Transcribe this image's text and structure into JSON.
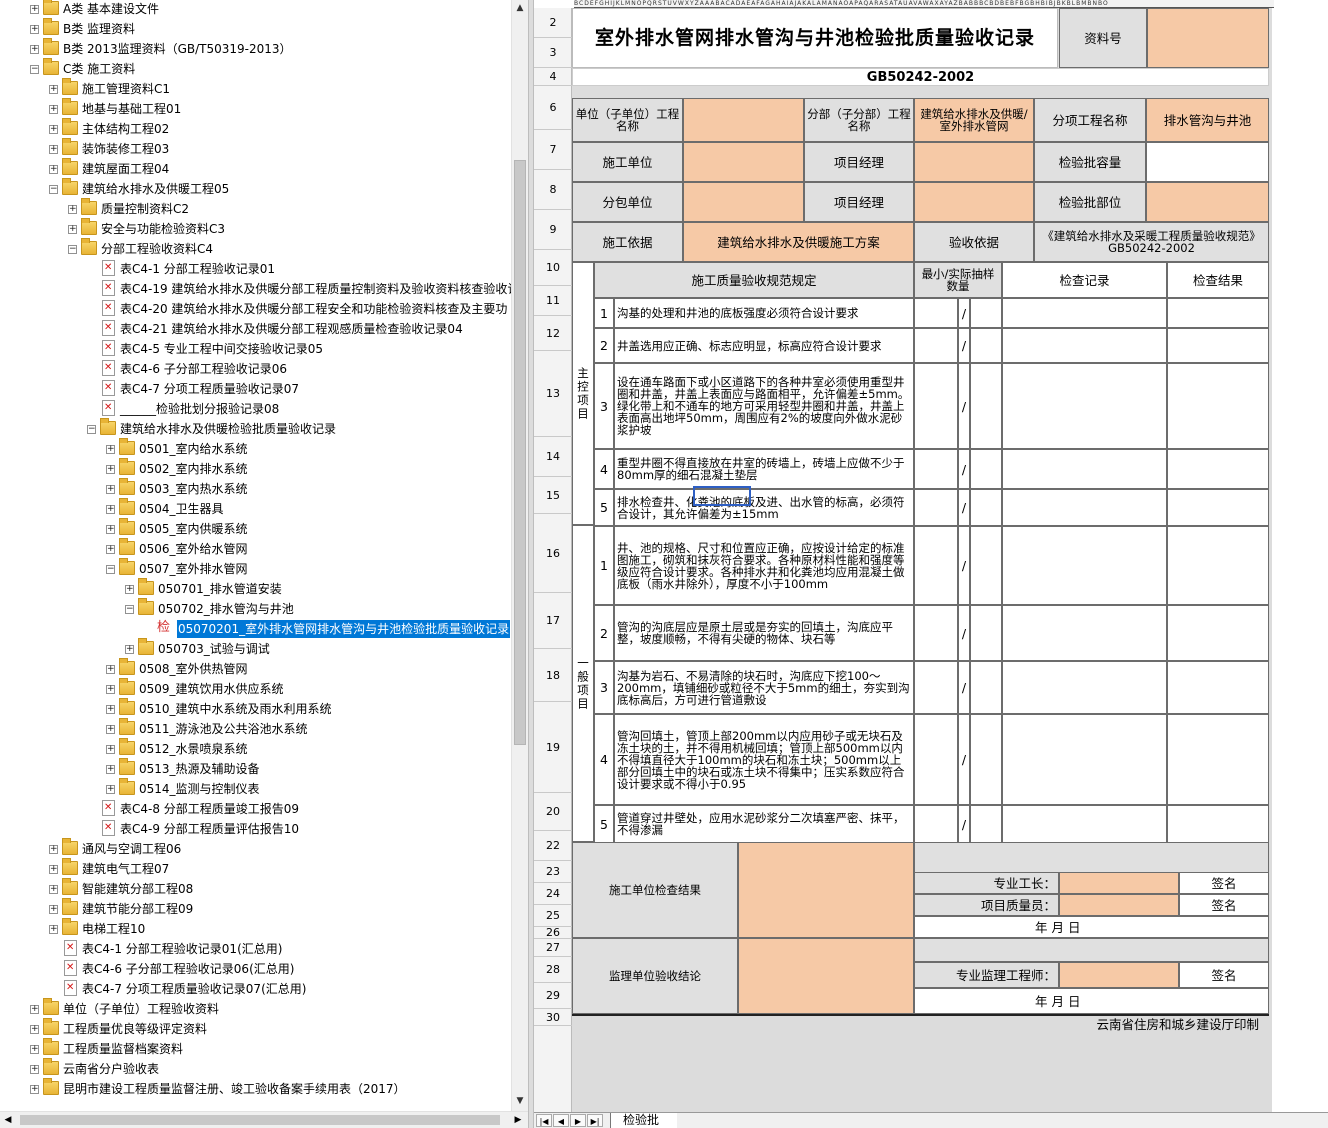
{
  "tree": {
    "items": [
      {
        "label": "A类 基本建设文件",
        "depth": 1,
        "type": "folder",
        "exp": "+"
      },
      {
        "label": "B类 监理资料",
        "depth": 1,
        "type": "folder",
        "exp": "+"
      },
      {
        "label": "B类 2013监理资料（GB/T50319-2013）",
        "depth": 1,
        "type": "folder",
        "exp": "+"
      },
      {
        "label": "C类 施工资料",
        "depth": 1,
        "type": "folder",
        "exp": "-"
      },
      {
        "label": "施工管理资料C1",
        "depth": 2,
        "type": "folder",
        "exp": "+"
      },
      {
        "label": "地基与基础工程01",
        "depth": 2,
        "type": "folder",
        "exp": "+"
      },
      {
        "label": "主体结构工程02",
        "depth": 2,
        "type": "folder",
        "exp": "+"
      },
      {
        "label": "装饰装修工程03",
        "depth": 2,
        "type": "folder",
        "exp": "+"
      },
      {
        "label": "建筑屋面工程04",
        "depth": 2,
        "type": "folder",
        "exp": "+"
      },
      {
        "label": "建筑给水排水及供暖工程05",
        "depth": 2,
        "type": "folder",
        "exp": "-"
      },
      {
        "label": "质量控制资料C2",
        "depth": 3,
        "type": "folder",
        "exp": "+"
      },
      {
        "label": "安全与功能检验资料C3",
        "depth": 3,
        "type": "folder",
        "exp": "+"
      },
      {
        "label": "分部工程验收资料C4",
        "depth": 3,
        "type": "folder",
        "exp": "-"
      },
      {
        "label": "表C4-1 分部工程验收记录01",
        "depth": 4,
        "type": "xls"
      },
      {
        "label": "表C4-19 建筑给水排水及供暖分部工程质量控制资料及验收资料核查验收记",
        "depth": 4,
        "type": "xls"
      },
      {
        "label": "表C4-20 建筑给水排水及供暖分部工程安全和功能检验资料核查及主要功",
        "depth": 4,
        "type": "xls"
      },
      {
        "label": "表C4-21 建筑给水排水及供暖分部工程观感质量检查验收记录04",
        "depth": 4,
        "type": "xls"
      },
      {
        "label": "表C4-5 专业工程中间交接验收记录05",
        "depth": 4,
        "type": "xls"
      },
      {
        "label": "表C4-6 子分部工程验收记录06",
        "depth": 4,
        "type": "xls"
      },
      {
        "label": "表C4-7 分项工程质量验收记录07",
        "depth": 4,
        "type": "xls"
      },
      {
        "label": "______检验批划分报验记录08",
        "depth": 4,
        "type": "xls"
      },
      {
        "label": "建筑给水排水及供暖检验批质量验收记录",
        "depth": 4,
        "type": "folder",
        "exp": "-"
      },
      {
        "label": "0501_室内给水系统",
        "depth": 5,
        "type": "folder",
        "exp": "+"
      },
      {
        "label": "0502_室内排水系统",
        "depth": 5,
        "type": "folder",
        "exp": "+"
      },
      {
        "label": "0503_室内热水系统",
        "depth": 5,
        "type": "folder",
        "exp": "+"
      },
      {
        "label": "0504_卫生器具",
        "depth": 5,
        "type": "folder",
        "exp": "+"
      },
      {
        "label": "0505_室内供暖系统",
        "depth": 5,
        "type": "folder",
        "exp": "+"
      },
      {
        "label": "0506_室外给水管网",
        "depth": 5,
        "type": "folder",
        "exp": "+"
      },
      {
        "label": "0507_室外排水管网",
        "depth": 5,
        "type": "folder",
        "exp": "-"
      },
      {
        "label": "050701_排水管道安装",
        "depth": 6,
        "type": "folder",
        "exp": "+"
      },
      {
        "label": "050702_排水管沟与井池",
        "depth": 6,
        "type": "folder",
        "exp": "-"
      },
      {
        "label": "05070201_室外排水管网排水管沟与井池检验批质量验收记录",
        "depth": 7,
        "type": "check",
        "selected": true,
        "icon_text": "检"
      },
      {
        "label": "050703_试验与调试",
        "depth": 6,
        "type": "folder",
        "exp": "+"
      },
      {
        "label": "0508_室外供热管网",
        "depth": 5,
        "type": "folder",
        "exp": "+"
      },
      {
        "label": "0509_建筑饮用水供应系统",
        "depth": 5,
        "type": "folder",
        "exp": "+"
      },
      {
        "label": "0510_建筑中水系统及雨水利用系统",
        "depth": 5,
        "type": "folder",
        "exp": "+"
      },
      {
        "label": "0511_游泳池及公共浴池水系统",
        "depth": 5,
        "type": "folder",
        "exp": "+"
      },
      {
        "label": "0512_水景喷泉系统",
        "depth": 5,
        "type": "folder",
        "exp": "+"
      },
      {
        "label": "0513_热源及辅助设备",
        "depth": 5,
        "type": "folder",
        "exp": "+"
      },
      {
        "label": "0514_监测与控制仪表",
        "depth": 5,
        "type": "folder",
        "exp": "+"
      },
      {
        "label": "表C4-8 分部工程质量竣工报告09",
        "depth": 4,
        "type": "xls"
      },
      {
        "label": "表C4-9 分部工程质量评估报告10",
        "depth": 4,
        "type": "xls"
      },
      {
        "label": "通风与空调工程06",
        "depth": 2,
        "type": "folder",
        "exp": "+"
      },
      {
        "label": "建筑电气工程07",
        "depth": 2,
        "type": "folder",
        "exp": "+"
      },
      {
        "label": "智能建筑分部工程08",
        "depth": 2,
        "type": "folder",
        "exp": "+"
      },
      {
        "label": "建筑节能分部工程09",
        "depth": 2,
        "type": "folder",
        "exp": "+"
      },
      {
        "label": "电梯工程10",
        "depth": 2,
        "type": "folder",
        "exp": "+"
      },
      {
        "label": "表C4-1 分部工程验收记录01(汇总用)",
        "depth": 2,
        "type": "xls"
      },
      {
        "label": "表C4-6 子分部工程验收记录06(汇总用)",
        "depth": 2,
        "type": "xls"
      },
      {
        "label": "表C4-7 分项工程质量验收记录07(汇总用)",
        "depth": 2,
        "type": "xls"
      },
      {
        "label": "单位（子单位）工程验收资料",
        "depth": 1,
        "type": "folder",
        "exp": "+"
      },
      {
        "label": "工程质量优良等级评定资料",
        "depth": 1,
        "type": "folder",
        "exp": "+"
      },
      {
        "label": "工程质量监督档案资料",
        "depth": 1,
        "type": "folder",
        "exp": "+"
      },
      {
        "label": "云南省分户验收表",
        "depth": 1,
        "type": "folder",
        "exp": "+"
      },
      {
        "label": "昆明市建设工程质量监督注册、竣工验收备案手续用表（2017）",
        "depth": 1,
        "type": "folder",
        "exp": "+"
      }
    ]
  },
  "sheet": {
    "column_letters": "BCDEFGHIJKLMNOPQRSTUVWXYZAAABACADAEAFAGAHAIAJAKALAMANAOAPAQARASATAUAVAWAXAYAZBABBBCBDBEBFBGBHBIBJBKBLBMBNBO",
    "rows": [
      {
        "n": "2",
        "h": 30
      },
      {
        "n": "3",
        "h": 30
      },
      {
        "n": "4",
        "h": 18
      },
      {
        "n": "6",
        "h": 44
      },
      {
        "n": "7",
        "h": 40
      },
      {
        "n": "8",
        "h": 40
      },
      {
        "n": "9",
        "h": 40
      },
      {
        "n": "10",
        "h": 36
      },
      {
        "n": "11",
        "h": 30
      },
      {
        "n": "12",
        "h": 35
      },
      {
        "n": "13",
        "h": 86
      },
      {
        "n": "14",
        "h": 40
      },
      {
        "n": "15",
        "h": 37
      },
      {
        "n": "16",
        "h": 79
      },
      {
        "n": "17",
        "h": 56
      },
      {
        "n": "18",
        "h": 53
      },
      {
        "n": "19",
        "h": 91
      },
      {
        "n": "20",
        "h": 38
      },
      {
        "n": "22",
        "h": 30
      },
      {
        "n": "23",
        "h": 22
      },
      {
        "n": "24",
        "h": 22
      },
      {
        "n": "25",
        "h": 22
      },
      {
        "n": "26",
        "h": 12
      },
      {
        "n": "27",
        "h": 18
      },
      {
        "n": "28",
        "h": 26
      },
      {
        "n": "29",
        "h": 26
      },
      {
        "n": "30",
        "h": 17
      }
    ],
    "title": "室外排水管网排水管沟与井池检验批质量验收记录",
    "doc_no_label": "资料号",
    "standard": "GB50242-2002",
    "unit_label": "单位（子单位）工程名称",
    "subdiv_label": "分部（子分部）工程名称",
    "subdiv_value": "建筑给水排水及供暖/室外排水管网",
    "item_label": "分项工程名称",
    "item_value": "排水管沟与井池",
    "contractor_label": "施工单位",
    "pm_label": "项目经理",
    "batch_qty_label": "检验批容量",
    "sub_label": "分包单位",
    "pm2_label": "项目经理",
    "batch_part_label": "检验批部位",
    "basis_label": "施工依据",
    "basis_value": "建筑给水排水及供暖施工方案",
    "accept_basis_label": "验收依据",
    "accept_basis_value": "《建筑给水排水及采暖工程质量验收规范》GB50242-2002",
    "spec_label": "施工质量验收规范规定",
    "sample_label": "最小/实际抽样数量",
    "record_label": "检查记录",
    "result_label": "检查结果",
    "main_group": "主控项目",
    "general_group": "一般项目",
    "slash": "/",
    "main_items": [
      {
        "n": "1",
        "text": "沟基的处理和井池的底板强度必须符合设计要求"
      },
      {
        "n": "2",
        "text": "井盖选用应正确、标志应明显，标高应符合设计要求"
      },
      {
        "n": "3",
        "text": "设在通车路面下或小区道路下的各种井室必须使用重型井圈和井盖，井盖上表面应与路面相平，允许偏差±5mm。绿化带上和不通车的地方可采用轻型井圈和井盖，井盖上表面高出地坪50mm，周围应有2%的坡度向外做水泥砂浆护坡"
      },
      {
        "n": "4",
        "text": "重型井圈不得直接放在井室的砖墙上，砖墙上应做不少于80mm厚的细石混凝土垫层"
      },
      {
        "n": "5",
        "text": "排水检查井、化粪池的底板及进、出水管的标高，必须符合设计，其允许偏差为±15mm"
      }
    ],
    "general_items": [
      {
        "n": "1",
        "text": "井、池的规格、尺寸和位置应正确，应按设计给定的标准图施工，砌筑和抹灰符合要求。各种原材料性能和强度等级应符合设计要求。各种排水井和化粪池均应用混凝土做底板（雨水井除外），厚度不小于100mm"
      },
      {
        "n": "2",
        "text": "管沟的沟底层应是原土层或是夯实的回填土，沟底应平整，坡度顺畅，不得有尖硬的物体、块石等"
      },
      {
        "n": "3",
        "text": "沟基为岩石、不易清除的块石时，沟底应下挖100～200mm，填铺细砂或粒径不大于5mm的细土，夯实到沟底标高后，方可进行管道敷设"
      },
      {
        "n": "4",
        "text": "管沟回填土，管顶上部200mm以内应用砂子或无块石及冻土块的土，并不得用机械回填；管顶上部500mm以内不得填直径大于100mm的块石和冻土块；500mm以上部分回填土中的块石或冻土块不得集中；压实系数应符合设计要求或不得小于0.95"
      },
      {
        "n": "5",
        "text": "管道穿过井壁处，应用水泥砂浆分二次填塞严密、抹平，不得渗漏"
      }
    ],
    "contractor_result_label": "施工单位检查结果",
    "foreman_label": "专业工长：",
    "qa_label": "项目质量员：",
    "sign": "签名",
    "date_text": "年  月  日",
    "supervisor_label": "监理单位验收结论",
    "engineer_label": "专业监理工程师：",
    "printer": "云南省住房和城乡建设厅印制",
    "tab_name": "检验批"
  },
  "colors": {
    "peach": "#f6c9a6",
    "gray": "#e0e0e0",
    "select": "#0078d7"
  }
}
